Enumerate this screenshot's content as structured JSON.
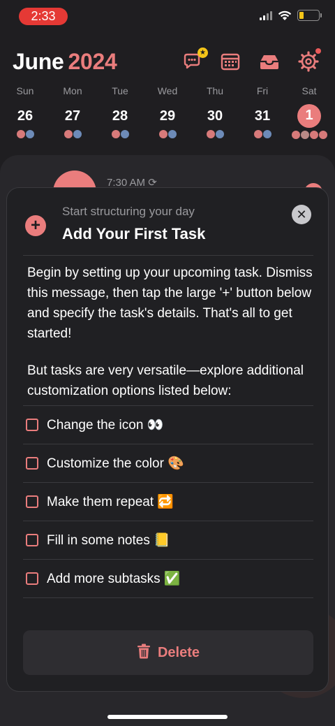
{
  "status_bar": {
    "time": "2:33"
  },
  "header": {
    "month": "June",
    "year": "2024"
  },
  "week": {
    "days": [
      {
        "name": "Sun",
        "date": "26"
      },
      {
        "name": "Mon",
        "date": "27"
      },
      {
        "name": "Tue",
        "date": "28"
      },
      {
        "name": "Wed",
        "date": "29"
      },
      {
        "name": "Thu",
        "date": "30"
      },
      {
        "name": "Fri",
        "date": "31"
      },
      {
        "name": "Sat",
        "date": "1"
      }
    ]
  },
  "background": {
    "event_time": "7:30 AM ⟳"
  },
  "modal": {
    "subtitle": "Start structuring your day",
    "title": "Add Your First Task",
    "paragraph1": "Begin by setting up your upcoming task. Dismiss this message, then tap the large '+' button below and specify the task's details. That's all to get started!",
    "paragraph2": "But tasks are very versatile—explore additional customization options listed below:",
    "checklist": [
      {
        "label": "Change the icon 👀"
      },
      {
        "label": "Customize the color 🎨"
      },
      {
        "label": "Make them repeat 🔁"
      },
      {
        "label": "Fill in some notes 📒"
      },
      {
        "label": "Add more subtasks ✅"
      }
    ],
    "delete_label": "Delete"
  },
  "colors": {
    "accent": "#ea7d7d",
    "background": "#1f1e21",
    "status_red": "#e53935"
  }
}
